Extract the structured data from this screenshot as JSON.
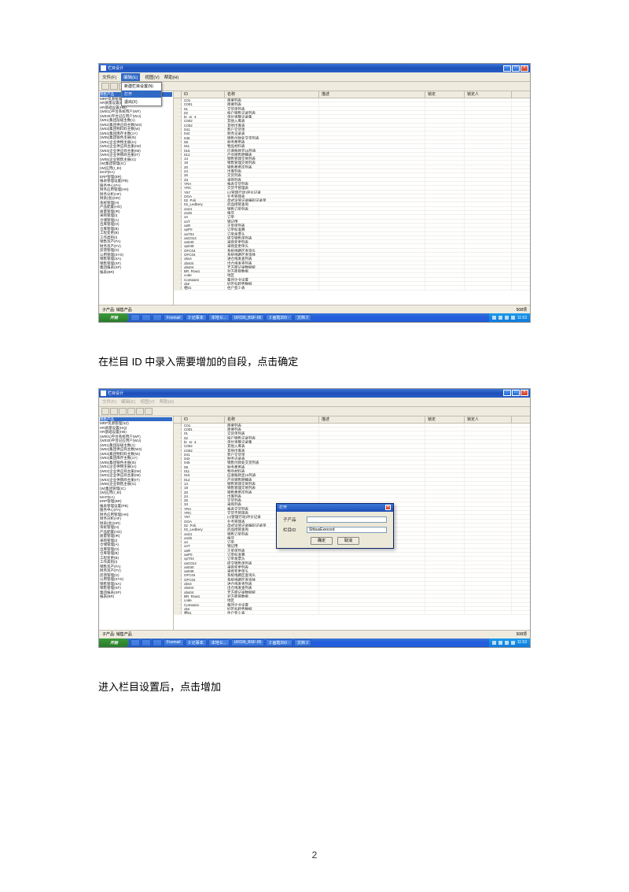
{
  "page_number": "2",
  "caption1": "在栏目 ID 中录入需要增加的自段，点击确定",
  "caption2": "进入栏目设置后，点击增加",
  "app": {
    "title": "栏目设计",
    "menus": [
      "文件(F)",
      "编辑(E)",
      "视图(V)",
      "帮助(H)"
    ],
    "dropdown": {
      "item1": "新建栏目设置(N)",
      "item2": "打开",
      "item3": "退出(X)"
    },
    "columns": {
      "id": "ID",
      "name": "名称",
      "desc": "描述",
      "lock": "锁定",
      "lockby": "锁定人"
    },
    "status_left": "子产品: 销售产品",
    "status_right": "508项"
  },
  "tree_items": [
    "销售产品",
    "  MRP资源管理(SZ)",
    "  HR质量设置(HQ)",
    "  HR基础设置(HB)",
    "  (W001)平台系统用户(WF)",
    "  (W030)平台记应用户(WU)",
    "  (W01)集团层级主数(1)",
    "  (W02)集团供应商主数(W2)",
    "  (W03)集团物料料主数(W)",
    "  (W04)集团库存主数(1Y)",
    "  (W05)集团银色主册(I5)",
    "  (W01)企业供物主册(IA)",
    "  (W02)企业供应商主册(IW)",
    "  (W03)企业供应商主册(IM)",
    "  (W04)企业供销商主册(IT)",
    "  (W05)企业销售主册(I1)",
    "  (W)集团管理(IC)",
    "  (W)应用(I_BI)",
    "  MAP(EA)",
    "  ERP管理(BR)",
    "  报表管理设置(PB)",
    "  服务中心(FA)",
    "  财务应用管理(HH)",
    "  财务分析(HF)",
    "  财表(会)(HR)",
    "  系统管理(H)",
    "  产品配置(HO)",
    "  质量管理(IR)",
    "  采购管理(I)",
    "  仓储管理(A)",
    "  出库管理(O)",
    "  仓库管理(B)",
    "  工程变更(B)",
    "  工作类别(I)",
    "  销售资产(FA)",
    "  财务资产(FV)",
    "  反馈管理(G)",
    "  公用管理(SYS)",
    "  销售管理(SA)",
    "  销售管理(SF)",
    "  集团报表(SP)",
    "  报表(BR)"
  ],
  "grid_rows": [
    {
      "id": "C01",
      "name": "简要列表",
      "desc": ""
    },
    {
      "id": "C001",
      "name": "简要列表",
      "desc": ""
    },
    {
      "id": "01",
      "name": "交货单列表",
      "desc": ""
    },
    {
      "id": "02",
      "name": "按户销售记录列表",
      "desc": ""
    },
    {
      "id": "br_er_4",
      "name": "单位清算记录集",
      "desc": ""
    },
    {
      "id": "C002",
      "name": "其他入库表",
      "desc": ""
    },
    {
      "id": "C002",
      "name": "其他出库表",
      "desc": ""
    },
    {
      "id": "041",
      "name": "客户交货单",
      "desc": ""
    },
    {
      "id": "042",
      "name": "财务记录表",
      "desc": ""
    },
    {
      "id": "045",
      "name": "销售付款处交货列表",
      "desc": ""
    },
    {
      "id": "08",
      "name": "财务费用表",
      "desc": ""
    },
    {
      "id": "011",
      "name": "物品材料表",
      "desc": ""
    },
    {
      "id": "015",
      "name": "应收账款显15列表",
      "desc": ""
    },
    {
      "id": "012",
      "name": "产品销售明细表",
      "desc": ""
    },
    {
      "id": "14",
      "name": "销售管理交易列表",
      "desc": ""
    },
    {
      "id": "18",
      "name": "销售管理交易列表",
      "desc": ""
    },
    {
      "id": "20",
      "name": "销售费用次列表",
      "desc": ""
    },
    {
      "id": "24",
      "name": "出库列表",
      "desc": ""
    },
    {
      "id": "25",
      "name": "交货列表",
      "desc": ""
    },
    {
      "id": "33",
      "name": "采购列表",
      "desc": ""
    },
    {
      "id": "YRA",
      "name": "报表交货列表",
      "desc": ""
    },
    {
      "id": "YRC",
      "name": "交货不管理表",
      "desc": ""
    },
    {
      "id": "Y67",
      "name": "(c)管理行动)评价记录",
      "desc": ""
    },
    {
      "id": "OOA",
      "name": "业务管理表",
      "desc": ""
    },
    {
      "id": "02_Poli_",
      "name": "母式设值记录编码记录单",
      "desc": ""
    },
    {
      "id": "02_Ledbery",
      "name": "药品授管查询",
      "desc": ""
    },
    {
      "id": "on24",
      "name": "销售订单列表",
      "desc": ""
    },
    {
      "id": "on25",
      "name": "报货",
      "desc": ""
    },
    {
      "id": "on",
      "name": "订单",
      "desc": ""
    },
    {
      "id": "onT",
      "name": "销记用",
      "desc": ""
    },
    {
      "id": "opR",
      "name": "正单单列表",
      "desc": ""
    },
    {
      "id": "opP0",
      "name": "订单标准算",
      "desc": ""
    },
    {
      "id": "opT04",
      "name": "订单发票头",
      "desc": ""
    },
    {
      "id": "opC014",
      "name": "提交销售单列表",
      "desc": ""
    },
    {
      "id": "op040",
      "name": "采购变更列表",
      "desc": ""
    },
    {
      "id": "op048",
      "name": "采购变更单头",
      "desc": ""
    },
    {
      "id": "OFC04",
      "name": "系统线路区查询头",
      "desc": ""
    },
    {
      "id": "OFC04",
      "name": "系统线路区查询体",
      "desc": ""
    },
    {
      "id": "obs4",
      "name": "进仓线发查列表",
      "desc": ""
    },
    {
      "id": "obs04",
      "name": "出仓线发查列表",
      "desc": ""
    },
    {
      "id": "obs04",
      "name": "无方面记录数据统",
      "desc": ""
    },
    {
      "id": "BR_Row1",
      "name": "对方面目数据",
      "desc": ""
    },
    {
      "id": "code",
      "name": "地区",
      "desc": ""
    },
    {
      "id": "Company",
      "name": "集团企业设置",
      "desc": ""
    },
    {
      "id": "oke",
      "name": "好区标趋势数据",
      "desc": ""
    },
    {
      "id": "相01",
      "name": "住户变少表",
      "desc": ""
    }
  ],
  "taskbar": {
    "start": "开始",
    "items": [
      "Foxmail",
      "2 记事本",
      "本地 E...",
      "UF036_BSF-05",
      "2 画笔350 -",
      "文档 2"
    ],
    "time": "11:53"
  },
  "dialog": {
    "title": "打开",
    "label1": "子产品",
    "label2": "栏目ID",
    "value2": "ShbusExecord",
    "ok": "确定",
    "cancel": "取消"
  }
}
